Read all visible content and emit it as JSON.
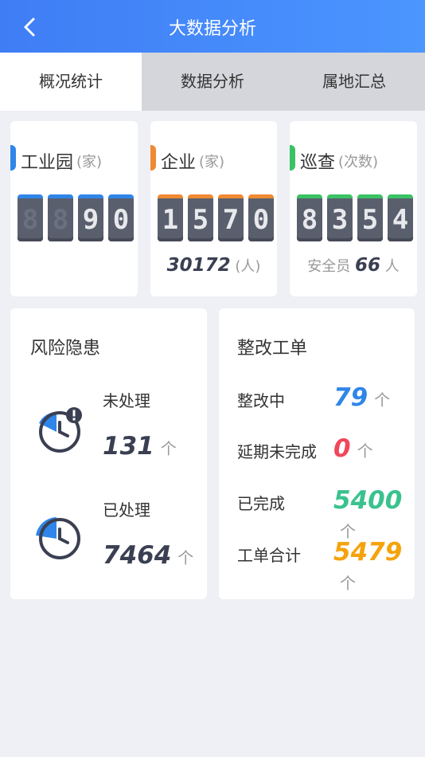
{
  "header": {
    "title": "大数据分析"
  },
  "tabs": [
    {
      "label": "概况统计",
      "active": true
    },
    {
      "label": "数据分析",
      "active": false
    },
    {
      "label": "属地汇总",
      "active": false
    }
  ],
  "stats": [
    {
      "name": "工业园",
      "unit": "(家)",
      "digits": [
        "8",
        "8",
        "9",
        "0"
      ],
      "dim": [
        true,
        true,
        false,
        false
      ],
      "color": "#2f86e8"
    },
    {
      "name": "企业",
      "unit": "(家)",
      "digits": [
        "1",
        "5",
        "7",
        "0"
      ],
      "dim": [
        false,
        false,
        false,
        false
      ],
      "color": "#ef8a32",
      "sub_value": "30172",
      "sub_unit": "(人)"
    },
    {
      "name": "巡查",
      "unit": "(次数)",
      "digits": [
        "8",
        "3",
        "5",
        "4"
      ],
      "dim": [
        false,
        false,
        false,
        false
      ],
      "color": "#3ac265",
      "sub_label": "安全员",
      "sub_value": "66",
      "sub_unit": "人"
    }
  ],
  "risk": {
    "title": "风险隐患",
    "pending_label": "未处理",
    "pending_value": "131",
    "done_label": "已处理",
    "done_value": "7464",
    "unit": "个"
  },
  "workorders": {
    "title": "整改工单",
    "unit": "个",
    "rows": [
      {
        "label": "整改中",
        "value": "79",
        "color": "#2f86e8"
      },
      {
        "label": "延期未完成",
        "value": "0",
        "color": "#f0475a"
      },
      {
        "label": "已完成",
        "value": "5400",
        "color": "#3ac28e"
      },
      {
        "label": "工单合计",
        "value": "5479",
        "color": "#f5a30d"
      }
    ]
  }
}
